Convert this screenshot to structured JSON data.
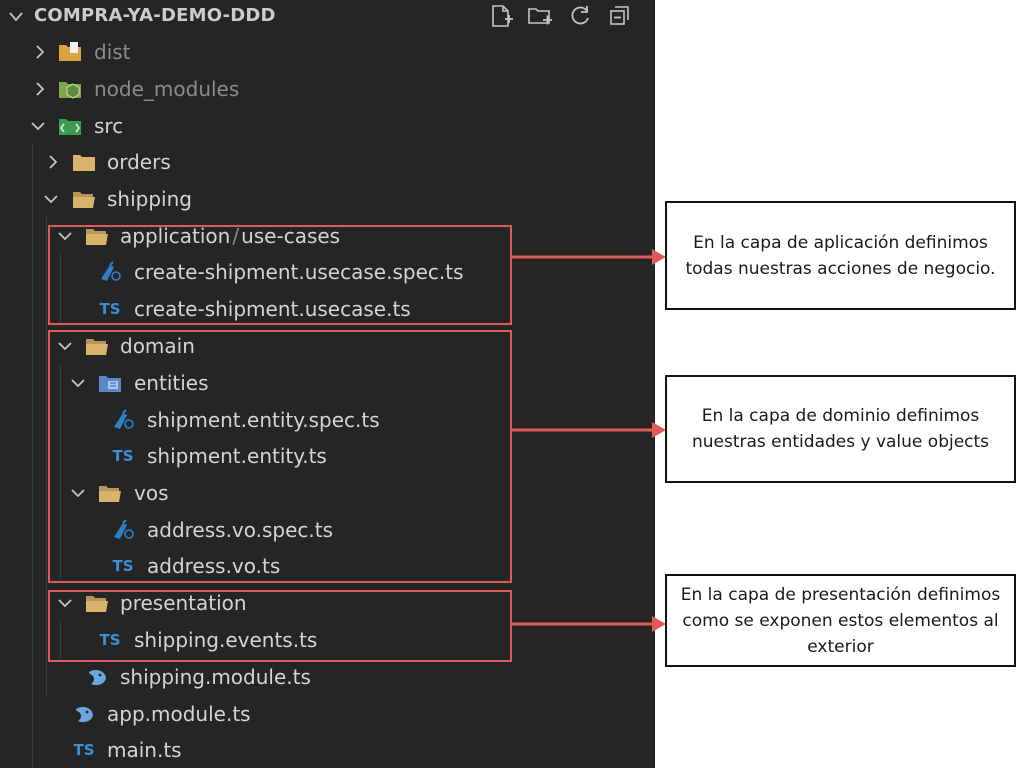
{
  "explorer": {
    "title": "COMPRA-YA-DEMO-DDD",
    "actions": [
      "new-file-icon",
      "new-folder-icon",
      "refresh-icon",
      "collapse-all-icon"
    ],
    "tree": [
      {
        "label": "dist",
        "type": "folder",
        "expanded": false,
        "dimmed": true
      },
      {
        "label": "node_modules",
        "type": "folder",
        "expanded": false,
        "dimmed": true
      },
      {
        "label": "src",
        "type": "folder",
        "expanded": true
      },
      {
        "label": "orders",
        "type": "folder",
        "expanded": false
      },
      {
        "label": "shipping",
        "type": "folder",
        "expanded": true
      },
      {
        "label": "application",
        "type": "folder",
        "expanded": true
      },
      {
        "label": "/",
        "type": "separator"
      },
      {
        "label": "use-cases",
        "type": "folder"
      },
      {
        "label": "create-shipment.usecase.spec.ts",
        "type": "spec"
      },
      {
        "label": "create-shipment.usecase.ts",
        "type": "ts"
      },
      {
        "label": "domain",
        "type": "folder",
        "expanded": true
      },
      {
        "label": "entities",
        "type": "folder",
        "expanded": true
      },
      {
        "label": "shipment.entity.spec.ts",
        "type": "spec"
      },
      {
        "label": "shipment.entity.ts",
        "type": "ts"
      },
      {
        "label": "vos",
        "type": "folder",
        "expanded": true
      },
      {
        "label": "address.vo.spec.ts",
        "type": "spec"
      },
      {
        "label": "address.vo.ts",
        "type": "ts"
      },
      {
        "label": "presentation",
        "type": "folder",
        "expanded": true
      },
      {
        "label": "shipping.events.ts",
        "type": "ts"
      },
      {
        "label": "shipping.module.ts",
        "type": "module"
      },
      {
        "label": "app.module.ts",
        "type": "module"
      },
      {
        "label": "main.ts",
        "type": "ts"
      }
    ],
    "ts_badge": "TS"
  },
  "annotations": [
    {
      "text": "En la capa de aplicación definimos todas nuestras acciones de negocio."
    },
    {
      "text": "En la capa de dominio definimos nuestras entidades y value objects"
    },
    {
      "text": "En la capa de presentación definimos como se exponen estos elementos al exterior"
    }
  ],
  "colors": {
    "background": "#252526",
    "highlight": "#e05a5a",
    "folder": "#d9b36b",
    "ts_blue": "#3b8fd6"
  }
}
